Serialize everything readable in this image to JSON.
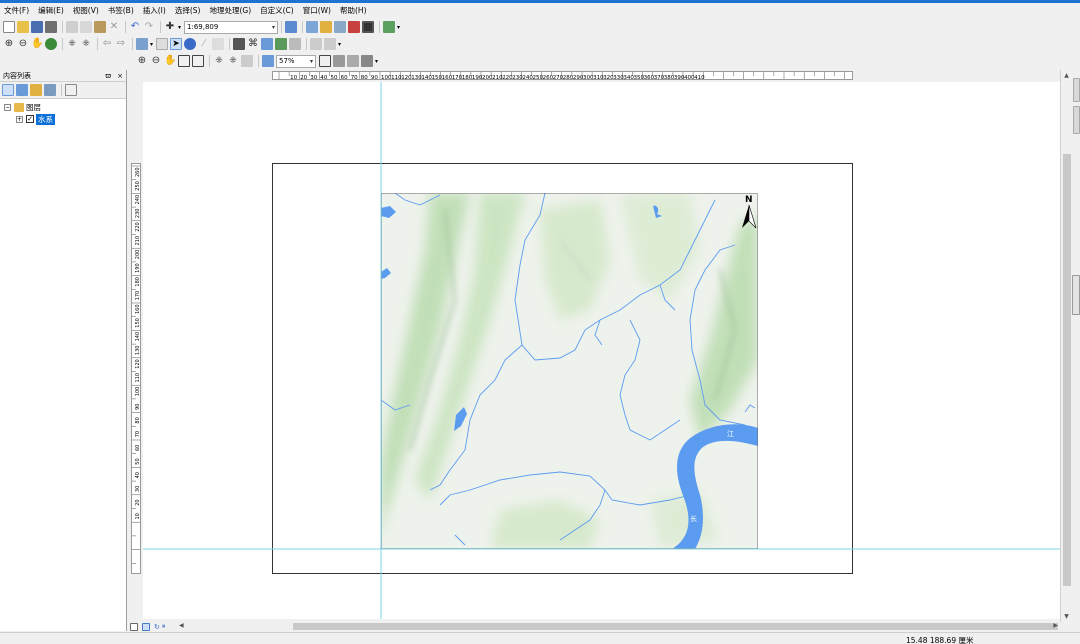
{
  "menu": [
    "文件(F)",
    "编辑(E)",
    "视图(V)",
    "书签(B)",
    "插入(I)",
    "选择(S)",
    "地理处理(G)",
    "自定义(C)",
    "窗口(W)",
    "帮助(H)"
  ],
  "scale_value": "1:69,809",
  "zoom_value": "57%",
  "toc": {
    "title": "内容列表",
    "pin": "ϖ",
    "close": "×",
    "group_label": "图层",
    "layer_label": "水系"
  },
  "map": {
    "north_label": "N",
    "river_label_1": "江",
    "river_label_2": "长"
  },
  "ruler_h_ticks": [
    "10",
    "20",
    "30",
    "40",
    "50",
    "60",
    "70",
    "80",
    "90",
    "100",
    "110",
    "120",
    "130",
    "140",
    "150",
    "160",
    "170",
    "180",
    "190",
    "200",
    "210",
    "220",
    "230",
    "240",
    "250",
    "260",
    "270",
    "280",
    "290",
    "300",
    "310",
    "320",
    "330",
    "340",
    "350",
    "360",
    "370",
    "380",
    "390",
    "400",
    "410"
  ],
  "ruler_v_ticks": [
    "260",
    "250",
    "240",
    "230",
    "220",
    "210",
    "200",
    "190",
    "180",
    "170",
    "160",
    "150",
    "140",
    "130",
    "120",
    "110",
    "100",
    "90",
    "80",
    "70",
    "60",
    "50",
    "40",
    "30",
    "20",
    "10"
  ],
  "status": {
    "coords": "15.48  188.69 厘米"
  },
  "colors": {
    "accent": "#1e73d2",
    "selection": "#0a6fd6",
    "river": "#5b9cf0",
    "terrain_green": "#b9dcae",
    "terrain_base": "#eef2ec",
    "guide_line": "#7fd4e6"
  }
}
